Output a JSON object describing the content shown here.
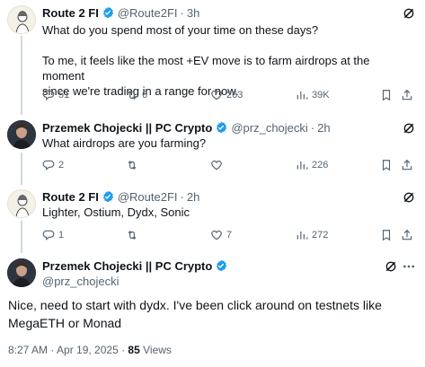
{
  "colors": {
    "verified": "#1d9bf0",
    "muted": "#536471",
    "text": "#0f1419",
    "thread_line": "#cfd9de"
  },
  "tweets": [
    {
      "name": "Route 2 FI",
      "handle": "@Route2FI",
      "separator": "·",
      "time": "3h",
      "text_lines": [
        "What do you spend most of your time on these days?",
        "",
        "To me, it feels like the most +EV move is to farm airdrops at the moment",
        "since we're trading in a range for now."
      ],
      "replies": "51",
      "reposts": "6",
      "likes": "263",
      "views": "39K"
    },
    {
      "name": "Przemek Chojecki || PC Crypto",
      "handle": "@prz_chojecki",
      "separator": "·",
      "time": "2h",
      "text_lines": [
        "What airdrops are you farming?"
      ],
      "replies": "2",
      "reposts": "",
      "likes": "",
      "views": "226"
    },
    {
      "name": "Route 2 FI",
      "handle": "@Route2FI",
      "separator": "·",
      "time": "2h",
      "text_lines": [
        "Lighter, Ostium, Dydx, Sonic"
      ],
      "replies": "1",
      "reposts": "",
      "likes": "7",
      "views": "272"
    }
  ],
  "main_tweet": {
    "name": "Przemek Chojecki || PC Crypto",
    "handle": "@prz_chojecki",
    "text_lines": [
      "Nice, need to start with dydx. I've been click around on testnets like",
      "MegaETH or Monad"
    ],
    "time": "8:27 AM · Apr 19, 2025 · ",
    "views_count": "85",
    "views_label": " Views"
  },
  "icons": {
    "more": "grok-icon",
    "reply": "reply-icon",
    "repost": "repost-icon",
    "like": "heart-icon",
    "views": "views-icon",
    "bookmark": "bookmark-icon",
    "share": "share-icon",
    "verified": "verified-badge-icon"
  }
}
